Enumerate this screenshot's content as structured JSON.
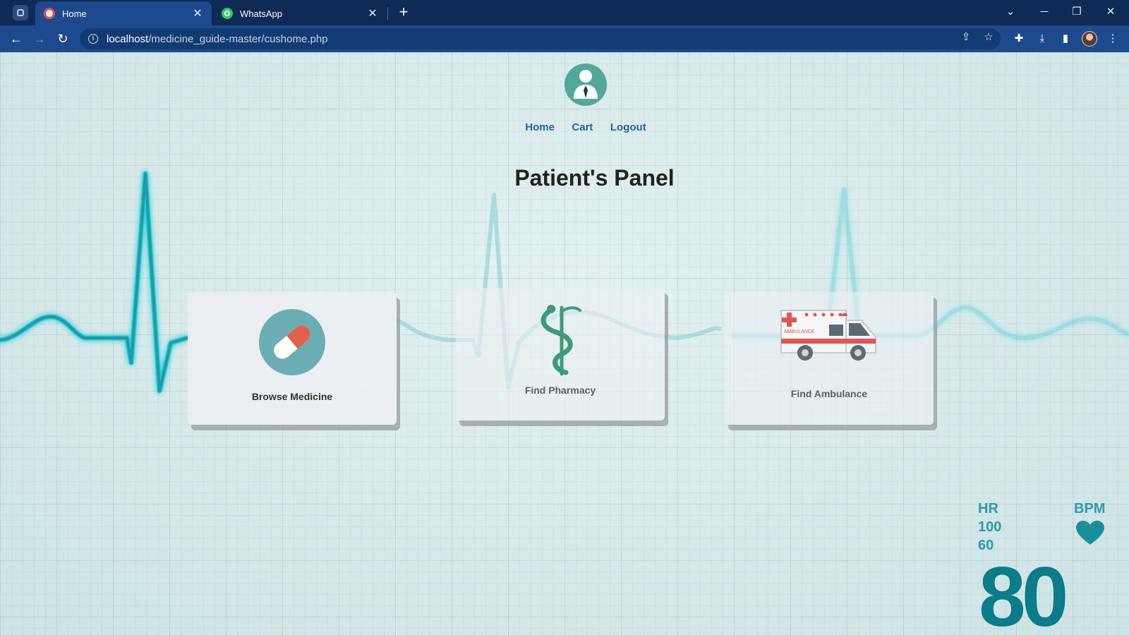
{
  "browser": {
    "tabs": [
      {
        "title": "Home",
        "active": true
      },
      {
        "title": "WhatsApp",
        "active": false
      }
    ],
    "url_host": "localhost",
    "url_path": "/medicine_guide-master/cushome.php",
    "window_controls": {
      "minimize": "─",
      "restore": "❐",
      "close": "✕"
    }
  },
  "page": {
    "nav": [
      "Home",
      "Cart",
      "Logout"
    ],
    "title": "Patient's Panel",
    "cards": [
      {
        "label": "Browse Medicine",
        "icon": "capsule-icon"
      },
      {
        "label": "Find Pharmacy",
        "icon": "caduceus-icon"
      },
      {
        "label": "Find Ambulance",
        "icon": "ambulance-icon"
      }
    ],
    "ambulance_text": "AMBULANCE",
    "monitor": {
      "hr_label": "HR",
      "hr_high": "100",
      "hr_low": "60",
      "bpm_label": "BPM",
      "bpm_value": "80"
    }
  },
  "colors": {
    "chrome": "#0e2a55",
    "toolbar": "#1d4a8c",
    "link": "#2361a8",
    "ecg": "#2bb3c0",
    "accent": "#52a89a"
  }
}
